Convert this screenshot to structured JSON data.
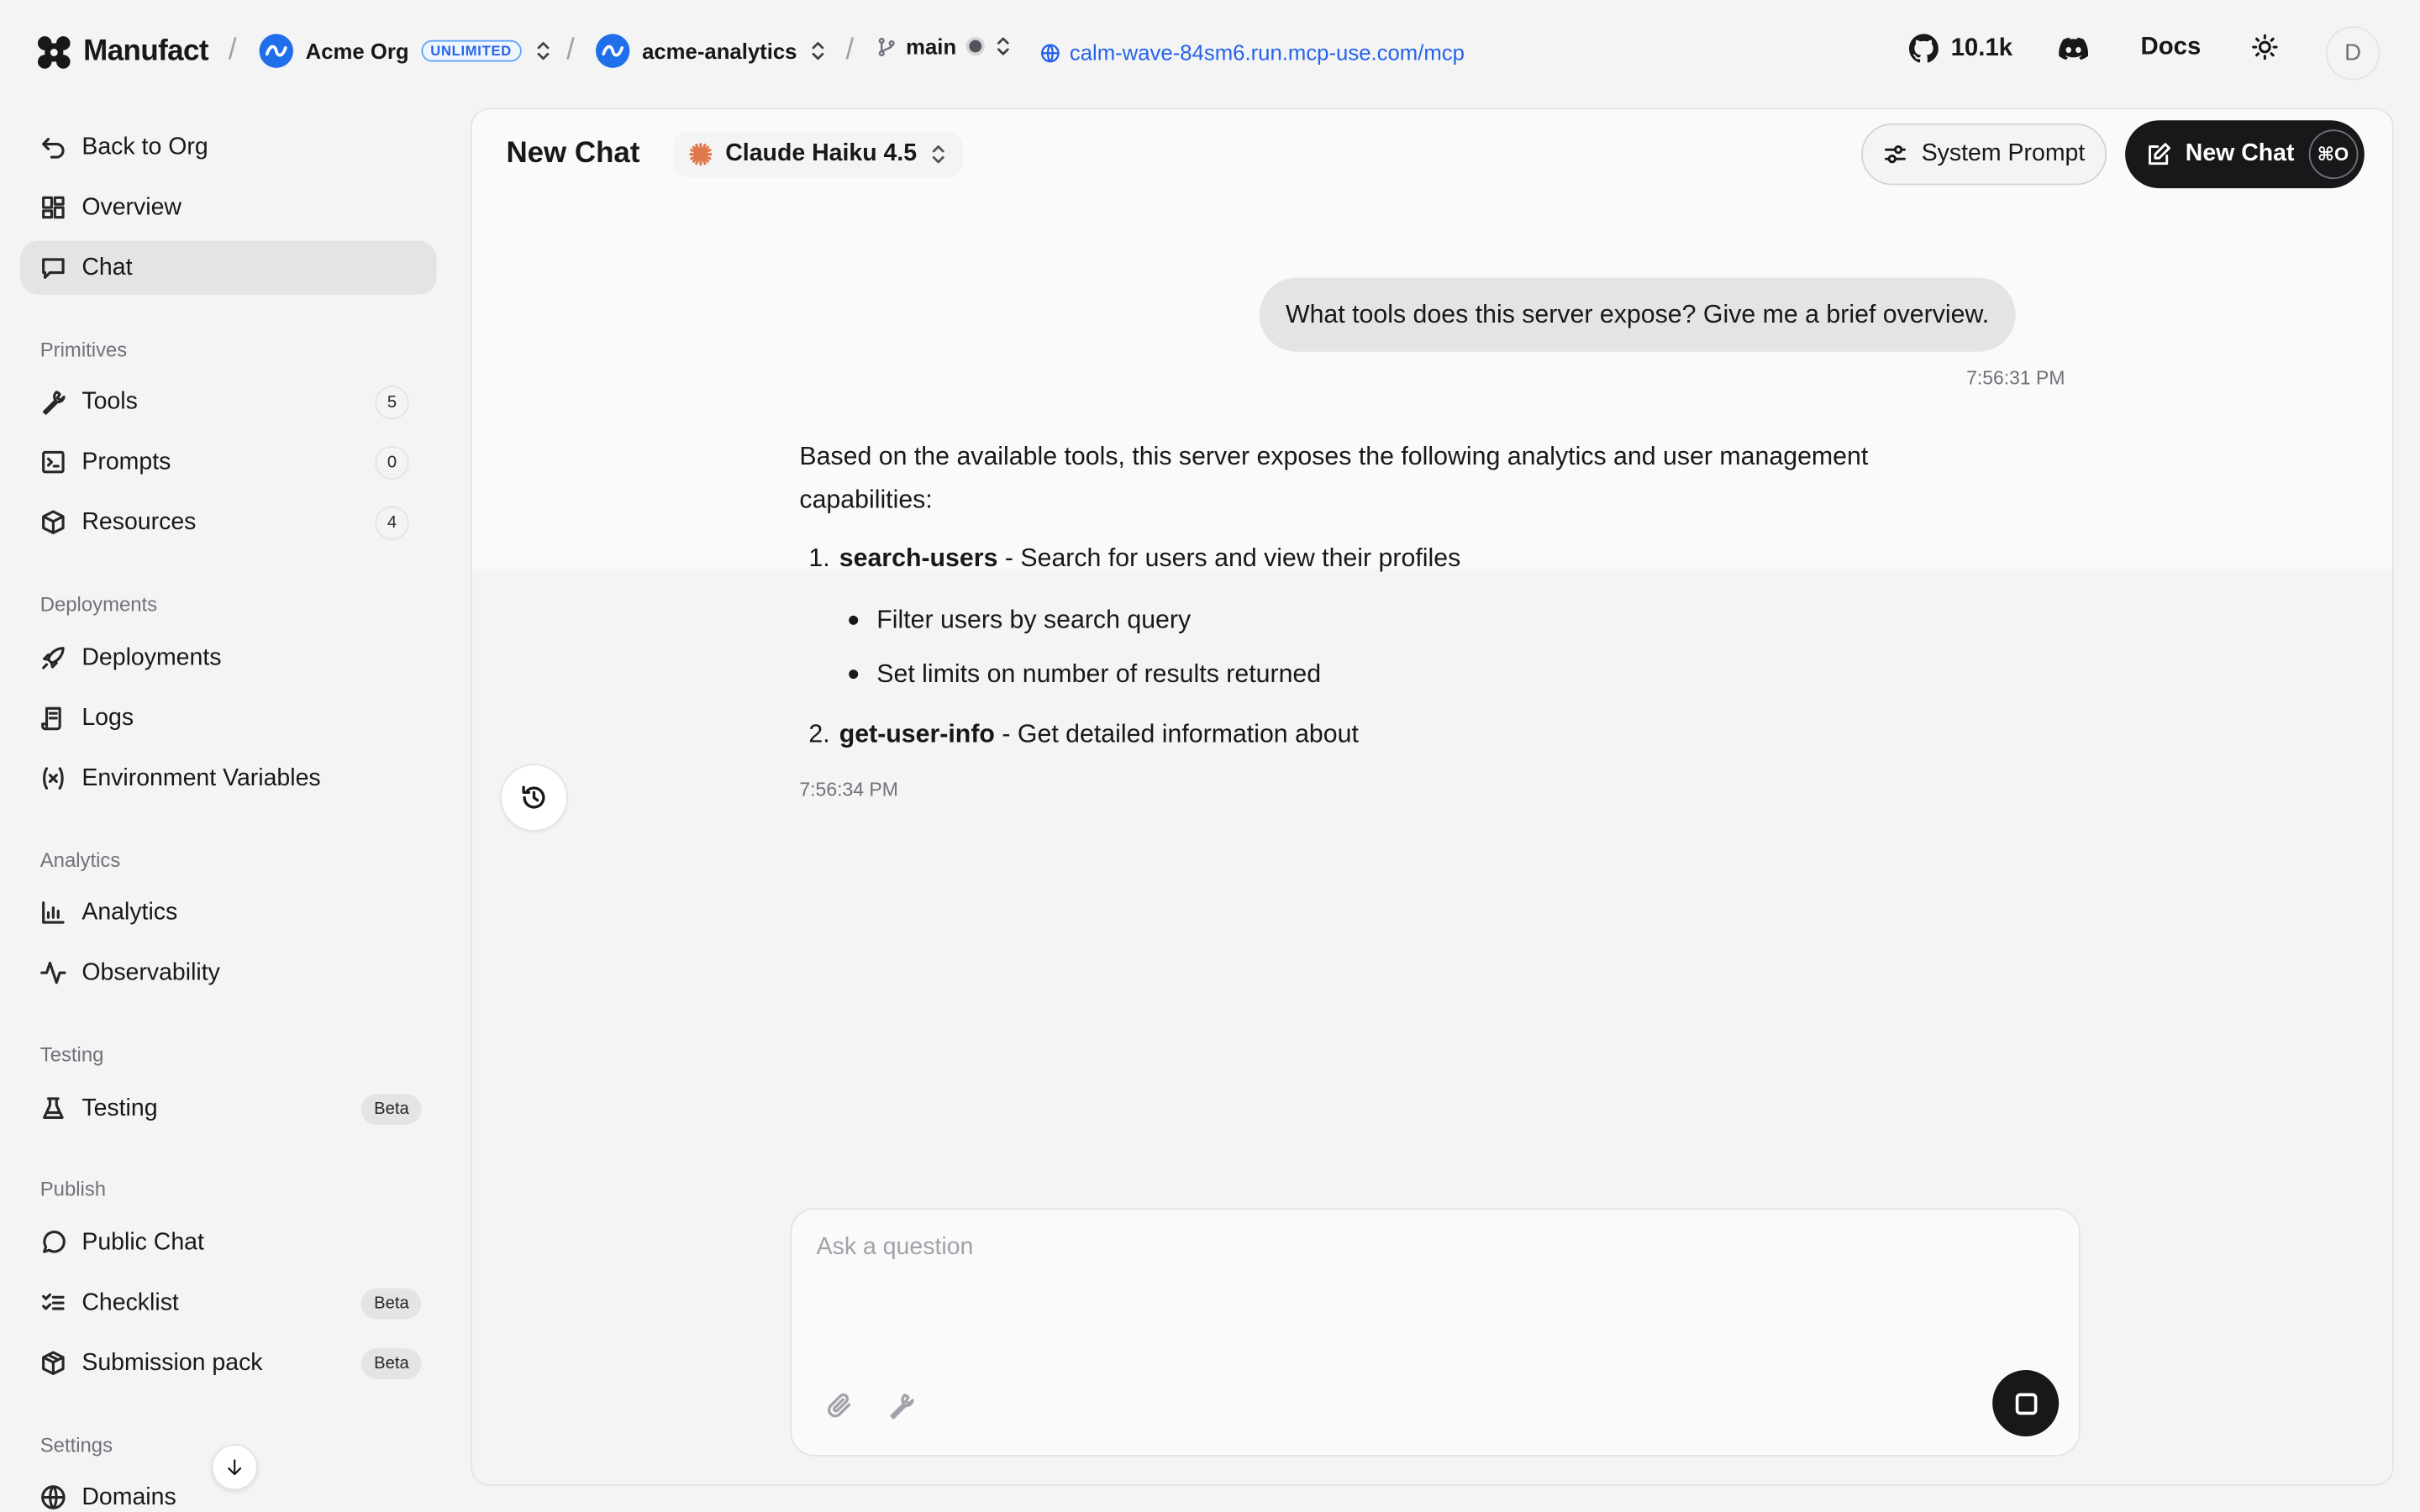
{
  "topbar": {
    "brand": "Manufact",
    "org": {
      "name": "Acme Org",
      "plan": "UNLIMITED"
    },
    "project": "acme-analytics",
    "branch": "main",
    "url": "calm-wave-84sm6.run.mcp-use.com/mcp",
    "github_stars": "10.1k",
    "docs_label": "Docs",
    "user_initial": "D"
  },
  "sidebar": {
    "back": "Back to Org",
    "overview": "Overview",
    "chat": "Chat",
    "sections": {
      "primitives": "Primitives",
      "deployments": "Deployments",
      "analytics": "Analytics",
      "testing": "Testing",
      "publish": "Publish",
      "settings": "Settings"
    },
    "tools": {
      "label": "Tools",
      "count": "5"
    },
    "prompts": {
      "label": "Prompts",
      "count": "0"
    },
    "resources": {
      "label": "Resources",
      "count": "4"
    },
    "deployments": "Deployments",
    "logs": "Logs",
    "env_vars": "Environment Variables",
    "analytics": "Analytics",
    "observability": "Observability",
    "testing": {
      "label": "Testing",
      "badge": "Beta"
    },
    "public_chat": "Public Chat",
    "checklist": {
      "label": "Checklist",
      "badge": "Beta"
    },
    "submission_pack": {
      "label": "Submission pack",
      "badge": "Beta"
    },
    "domains": "Domains"
  },
  "chat": {
    "title": "New Chat",
    "model": "Claude Haiku 4.5",
    "system_prompt_label": "System Prompt",
    "new_chat_label": "New Chat",
    "new_chat_shortcut": "⌘O",
    "user_message": "What tools does this server expose? Give me a brief overview.",
    "user_time": "7:56:31 PM",
    "assistant_intro": "Based on the available tools, this server exposes the following analytics and user management capabilities:",
    "items": [
      {
        "num": "1.",
        "name": "search-users",
        "desc": "- Search for users and view their profiles",
        "bullets": [
          "Filter users by search query",
          "Set limits on number of results returned"
        ]
      },
      {
        "num": "2.",
        "name": "get-user-info",
        "desc": "- Get detailed information about"
      }
    ],
    "assistant_time": "7:56:34 PM",
    "composer_placeholder": "Ask a question"
  },
  "colors": {
    "accent": "#2563eb",
    "dark": "#18181b",
    "model_icon": "#e0774a"
  }
}
